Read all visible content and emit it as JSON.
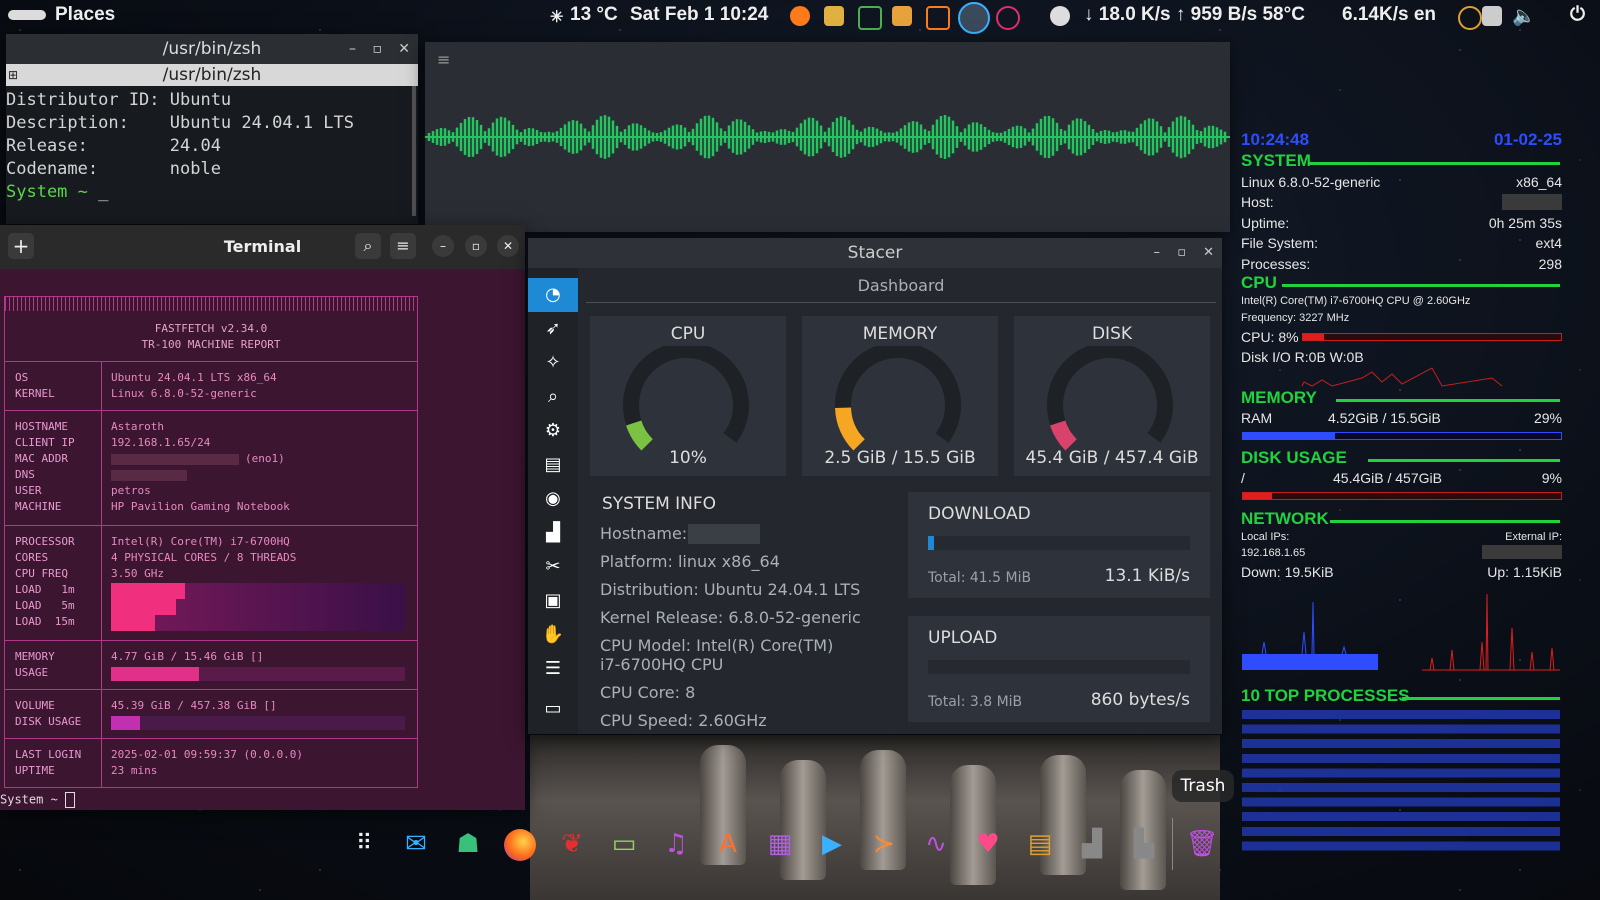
{
  "topbar": {
    "places": "Places",
    "weather": "13 °C",
    "datetime": "Sat Feb 1 10:24",
    "netstat": "↓ 18.0 K/s ↑ 959 B/s 58°C",
    "netstat2": "6.14K/s en"
  },
  "zsh": {
    "window_title": "/usr/bin/zsh",
    "tab_title": "/usr/bin/zsh",
    "lines": [
      "Distributor ID: Ubuntu",
      "Description:    Ubuntu 24.04.1 LTS",
      "Release:        24.04",
      "Codename:       noble"
    ],
    "prompt": "System ~",
    "cursor": "_"
  },
  "terminal": {
    "title": "Terminal",
    "prompt": "System ~",
    "fastfetch": {
      "header1": "FASTFETCH v2.34.0",
      "header2": "TR-100 MACHINE REPORT",
      "os_label": "OS",
      "os_value": "Ubuntu 24.04.1 LTS x86_64",
      "kernel_label": "KERNEL",
      "kernel_value": "Linux 6.8.0-52-generic",
      "hostname_label": "HOSTNAME",
      "hostname_value": "Astaroth",
      "clientip_label": "CLIENT IP",
      "clientip_value": "192.168.1.65/24",
      "mac_label": "MAC ADDR",
      "mac_suffix": "(eno1)",
      "dns_label": "DNS",
      "user_label": "USER",
      "user_value": "petros",
      "machine_label": "MACHINE",
      "machine_value": "HP Pavilion Gaming Notebook",
      "processor_label": "PROCESSOR",
      "processor_value": "Intel(R) Core(TM) i7-6700HQ",
      "cores_label": "CORES",
      "cores_value": "4 PHYSICAL CORES / 8 THREADS",
      "cpufreq_label": "CPU FREQ",
      "cpufreq_value": "3.50 GHz",
      "load1_label": "LOAD   1m",
      "load5_label": "LOAD   5m",
      "load15_label": "LOAD  15m",
      "load1_level": 0.25,
      "load5_level": 0.22,
      "load15_level": 0.15,
      "memory_label": "MEMORY",
      "usage_label": "USAGE",
      "memory_value": "4.77 GiB / 15.46 GiB []",
      "memory_level": 0.3,
      "volume_label": "VOLUME",
      "disk_label": "DISK USAGE",
      "volume_value": "45.39 GiB / 457.38 GiB []",
      "volume_level": 0.1,
      "lastlogin_label": "LAST LOGIN",
      "lastlogin_value": "2025-02-01 09:59:37 (0.0.0.0)",
      "uptime_label": "UPTIME",
      "uptime_value": "23 mins"
    }
  },
  "stacer": {
    "title": "Stacer",
    "page": "Dashboard",
    "cpu": {
      "title": "CPU",
      "value": "10%",
      "level": 0.1,
      "color": "#7cc242"
    },
    "memory": {
      "title": "MEMORY",
      "value": "2.5 GiB / 15.5 GiB",
      "level": 0.16,
      "color": "#f5a623"
    },
    "disk": {
      "title": "DISK",
      "value": "45.4 GiB / 457.4 GiB",
      "level": 0.1,
      "color": "#d8426b"
    },
    "sysinfo": {
      "title": "SYSTEM INFO",
      "hostname": "Hostname:",
      "platform": "Platform: linux x86_64",
      "distribution": "Distribution: Ubuntu 24.04.1 LTS",
      "kernel": "Kernel Release: 6.8.0-52-generic",
      "cpu_model1": "CPU Model: Intel(R) Core(TM)",
      "cpu_model2": "i7-6700HQ CPU",
      "cpu_core": "CPU Core: 8",
      "cpu_speed": "CPU Speed: 2.60GHz"
    },
    "download": {
      "title": "DOWNLOAD",
      "total": "Total: 41.5 MiB",
      "rate": "13.1 KiB/s",
      "level": 0.02
    },
    "upload": {
      "title": "UPLOAD",
      "total": "Total: 3.8 MiB",
      "rate": "860 bytes/s",
      "level": 0.0
    }
  },
  "conky": {
    "time": "10:24:48",
    "date": "01-02-25",
    "system_h": "SYSTEM",
    "kernel": "Linux 6.8.0-52-generic",
    "arch": "x86_64",
    "host_label": "Host:",
    "uptime_label": "Uptime:",
    "uptime_value": "0h 25m 35s",
    "fs_label": "File System:",
    "fs_value": "ext4",
    "proc_label": "Processes:",
    "proc_value": "298",
    "cpu_h": "CPU",
    "cpu_model": "Intel(R) Core(TM) i7-6700HQ CPU @ 2.60GHz",
    "frequency": "Frequency: 3227 MHz",
    "cpu_pct": "CPU: 8%",
    "cpu_level": 0.08,
    "diskio": "Disk I/O R:0B W:0B",
    "memory_h": "MEMORY",
    "ram_label": "RAM",
    "ram_value": "4.52GiB / 15.5GiB",
    "ram_pct": "29%",
    "ram_level": 0.29,
    "disk_h": "DISK USAGE",
    "disk_mount": "/",
    "disk_value": "45.4GiB / 457GiB",
    "disk_pct": "9%",
    "disk_level": 0.09,
    "network_h": "NETWORK",
    "local_ips": "Local IPs:",
    "external_ip": "External IP:",
    "local_ip": "192.168.1.65",
    "down": "Down: 19.5KiB",
    "up": "Up: 1.15KiB",
    "top_h": "10 TOP PROCESSES"
  },
  "dock": {
    "trash_tooltip": "Trash"
  }
}
